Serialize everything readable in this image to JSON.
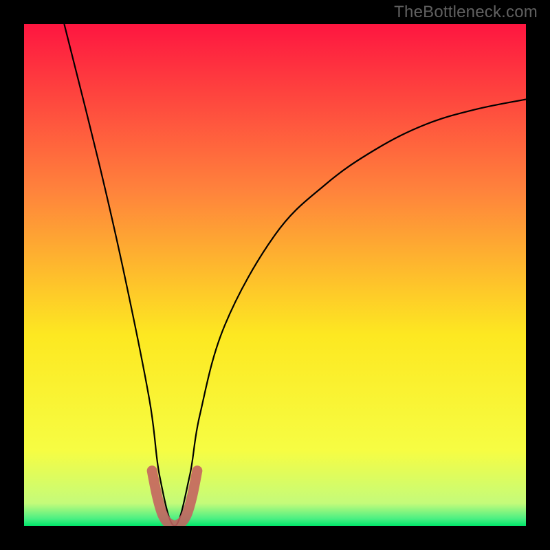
{
  "watermark": "TheBottleneck.com",
  "chart_data": {
    "type": "line",
    "title": "",
    "xlabel": "",
    "ylabel": "",
    "xlim": [
      0,
      100
    ],
    "ylim": [
      0,
      100
    ],
    "background_gradient": {
      "top": "#fe1640",
      "mid_upper": "#ff823c",
      "mid": "#fde821",
      "mid_lower": "#f6fd43",
      "bottom": "#00e66a"
    },
    "series": [
      {
        "name": "bottleneck-curve",
        "color": "#000000",
        "x": [
          8,
          15,
          20,
          25,
          27,
          30,
          33,
          35,
          40,
          50,
          60,
          70,
          80,
          90,
          100
        ],
        "y": [
          100,
          72,
          50,
          25,
          10,
          0,
          10,
          22,
          40,
          58,
          68,
          75,
          80,
          83,
          85
        ]
      },
      {
        "name": "optimal-zone-marker",
        "color": "#c46060",
        "thick": true,
        "x": [
          25.5,
          26.5,
          27.5,
          28.5,
          29.5,
          30,
          30.5,
          31.5,
          32.5,
          33.5,
          34.5
        ],
        "y": [
          11,
          6,
          2.5,
          0.8,
          0.2,
          0,
          0.2,
          0.8,
          2.5,
          6,
          11
        ]
      }
    ]
  }
}
